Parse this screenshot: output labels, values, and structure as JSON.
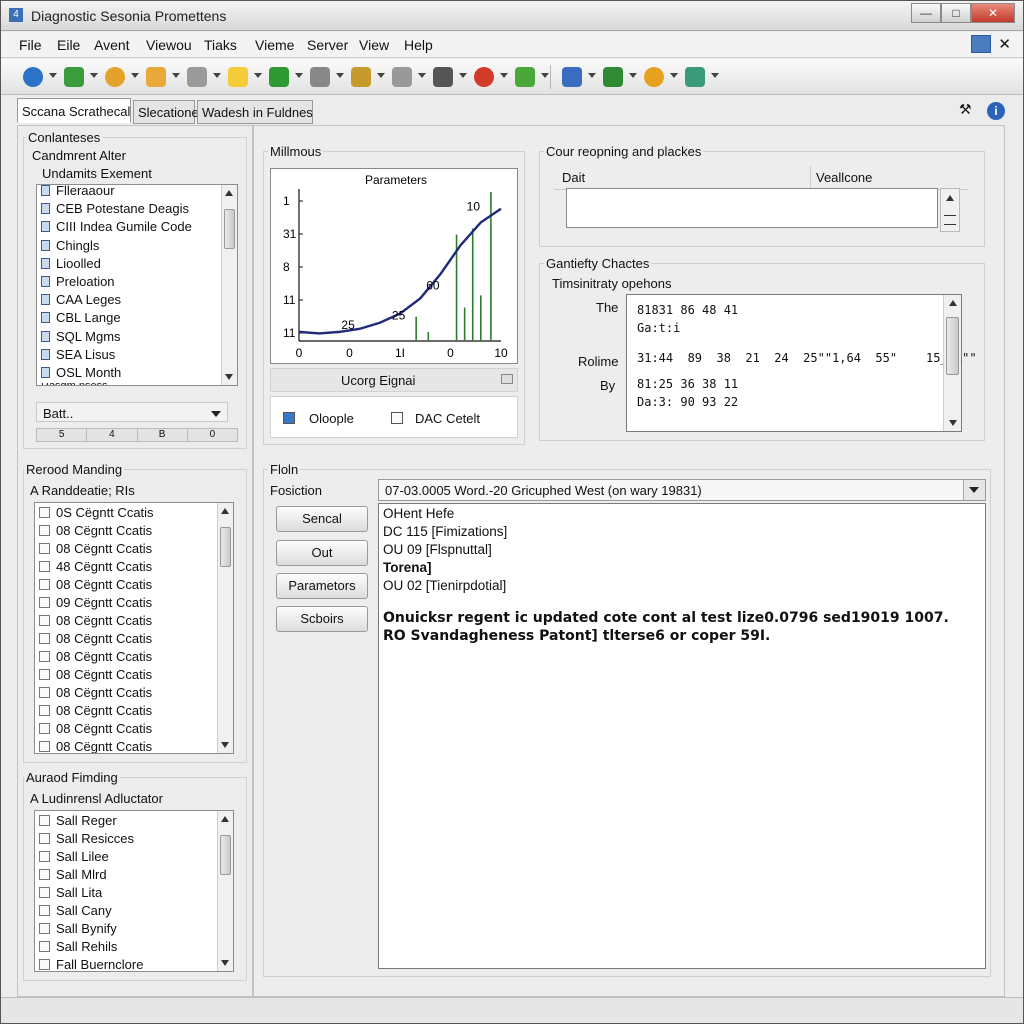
{
  "window": {
    "title": "Diagnostic Sesonia Promettens",
    "app_icon": "4",
    "min_label": "—",
    "max_label": "□",
    "close_label": "✕"
  },
  "menu": {
    "items": [
      "File",
      "Eile",
      "Avent",
      "Viewou",
      "Tiaks",
      "Vieme",
      "Server",
      "View",
      "Help"
    ],
    "close_label": "✕"
  },
  "toolbar": {
    "icons": [
      "globe-icon",
      "save-icon",
      "add-icon",
      "folder-icon",
      "table-icon",
      "note-icon",
      "home-icon",
      "link-icon",
      "user-icon",
      "thermometer-icon",
      "gem-icon",
      "stop-icon",
      "forward-icon",
      "grid-icon",
      "export-icon",
      "smiley-icon",
      "wand-icon"
    ],
    "colors": [
      "#2a73c9",
      "#3b9c3b",
      "#e5a22a",
      "#e8a93a",
      "#9a9a9a",
      "#f3cc3a",
      "#2f9a33",
      "#888888",
      "#c79a2e",
      "#999999",
      "#555555",
      "#d23a2a",
      "#4aa83a",
      "#3a6cc0",
      "#2f8a33",
      "#e6a21f",
      "#3a9a7a"
    ]
  },
  "tabs": [
    {
      "label": "Sccana Scrathecal",
      "active": true
    },
    {
      "label": "Slecatione",
      "active": false
    },
    {
      "label": "Wadesh in Fuldnes",
      "active": false
    }
  ],
  "left_top": {
    "header": "Conlanteses",
    "group1": "Candmrent Alter",
    "group2": "Undamits Exement",
    "items": [
      "Flleraaour",
      "CEB Potestane Deagis",
      "CIII Indea Gumile Code",
      "Chingls",
      "Lioolled",
      "Preloation",
      "CAA Leges",
      "CBL Lange",
      "SQL Mgms",
      "SEA Lisus",
      "OSL Month"
    ],
    "cut_item": "Rasgm nsess",
    "dropdown": "Batt..",
    "strip": [
      "5",
      "4",
      "B",
      "0"
    ]
  },
  "left_mid": {
    "header": "Rerood Manding",
    "sub": "A Randdeatie; RIs",
    "items": [
      "0S Cëgntt Ccatis",
      "08 Cëgntt Ccatis",
      "08 Cëgntt Ccatis",
      "48 Cëgntt Ccatis",
      "08 Cëgntt Ccatis",
      "09 Cëgntt Ccatis",
      "08 Cëgntt Ccatis",
      "08 Cëgntt Ccatis",
      "08 Cëgntt Ccatis",
      "08 Cëgntt Ccatis",
      "08 Cëgntt Ccatis",
      "08 Cëgntt Ccatis",
      "08 Cëgntt Ccatis",
      "08 Cëgntt Ccatis"
    ]
  },
  "left_bottom": {
    "header": "Auraod Fimding",
    "sub": "A Ludinrensl Adluctator",
    "items": [
      "Sall Reger",
      "Sall Resicces",
      "Sall Lilee",
      "Sall Mlrd",
      "Sall Lita",
      "Sall Cany",
      "Sall Bynify",
      "Sall Rehils",
      "Fall Buernclore"
    ]
  },
  "center_top": {
    "header": "Millmous",
    "chart_panel_label": "Ucorg Eignai",
    "check1": "Oloople",
    "check2": "DAC Cetelt"
  },
  "chart_data": {
    "type": "line",
    "title": "Parameters",
    "ytick_labels": [
      "1",
      "31",
      "8",
      "11",
      "11"
    ],
    "xtick_labels": [
      "0",
      "0",
      "1I",
      "0",
      "10"
    ],
    "annotations": [
      "10",
      "60",
      "25",
      "25"
    ],
    "series": [
      {
        "values": [
          [
            0,
            0.6
          ],
          [
            1,
            0.5
          ],
          [
            2,
            0.6
          ],
          [
            3,
            0.8
          ],
          [
            4,
            1.2
          ],
          [
            5,
            1.8
          ],
          [
            6,
            2.8
          ],
          [
            7,
            4.4
          ],
          [
            8,
            6.3
          ],
          [
            9,
            7.8
          ],
          [
            10,
            8.7
          ]
        ]
      }
    ],
    "spikes": [
      [
        5.8,
        1.6
      ],
      [
        6.4,
        0.6
      ],
      [
        7.8,
        7.0
      ],
      [
        8.2,
        2.2
      ],
      [
        8.6,
        7.4
      ],
      [
        9.0,
        3.0
      ],
      [
        9.5,
        9.8
      ]
    ],
    "xlim": [
      0,
      10
    ],
    "ylim": [
      0,
      10
    ],
    "line_color": "#1f2a7a",
    "spike_color": "#2f7a2f"
  },
  "right_top": {
    "header": "Cour reopning and plackes",
    "col1": "Dait",
    "col2": "Veallcone",
    "input_value": ""
  },
  "right_mid": {
    "header": "Gantiefty Chactes",
    "sub": "Timsinitraty opehons",
    "label_the": "The",
    "label_rolime": "Rolime",
    "label_by": "By",
    "lines": [
      "81831  86  48  41",
      "Ga:t:i",
      "31:44  89  38  21  24  25\"\"1,64  55\"    15_OL\"\"",
      "81:25  36  38  11",
      "Da:3:  90  93  22"
    ]
  },
  "bottom": {
    "header": "Floln",
    "position_label": "Fosiction",
    "position_value": "07-03.0005 Word.-20 Gricuphed West (on wary 19831)",
    "buttons": [
      "Sencal",
      "Out",
      "Parametors",
      "Scboirs"
    ],
    "log_lines": [
      "OHent Hefe",
      "DC 115  [Fimizations]",
      "OU 09 [Flspnuttal]",
      "Torena]",
      "OU 02 [Tienirpdotial]"
    ],
    "log_bold_1": "Onuicksr regent ic updated cote cont al test lize0.0796 sed19019 1007.",
    "log_bold_2": "RO Svandagheness Patont] tlterse6 or coper 59I."
  }
}
